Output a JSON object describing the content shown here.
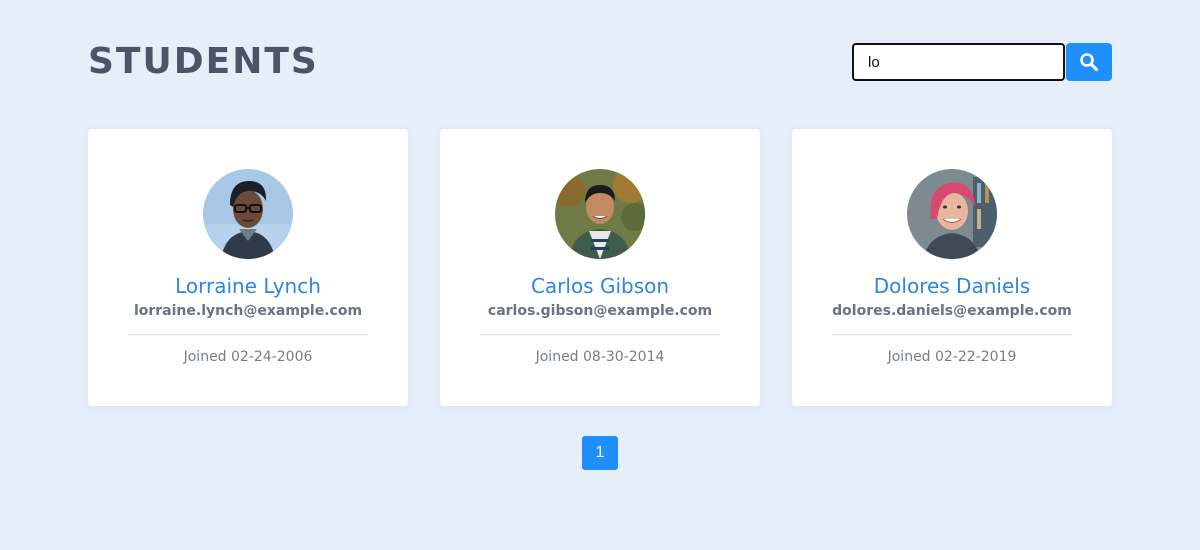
{
  "header": {
    "title": "STUDENTS",
    "search": {
      "value": "lo",
      "placeholder": "",
      "button_icon": "search-icon"
    }
  },
  "students": [
    {
      "name": "Lorraine Lynch",
      "email": "lorraine.lynch@example.com",
      "joined": "Joined 02-24-2006"
    },
    {
      "name": "Carlos Gibson",
      "email": "carlos.gibson@example.com",
      "joined": "Joined 08-30-2014"
    },
    {
      "name": "Dolores Daniels",
      "email": "dolores.daniels@example.com",
      "joined": "Joined 02-22-2019"
    }
  ],
  "pagination": {
    "pages": [
      "1"
    ],
    "current": "1"
  },
  "colors": {
    "background": "#e6eefa",
    "accent": "#1e8ffb",
    "name": "#2b87e1",
    "title": "#4a5568"
  }
}
